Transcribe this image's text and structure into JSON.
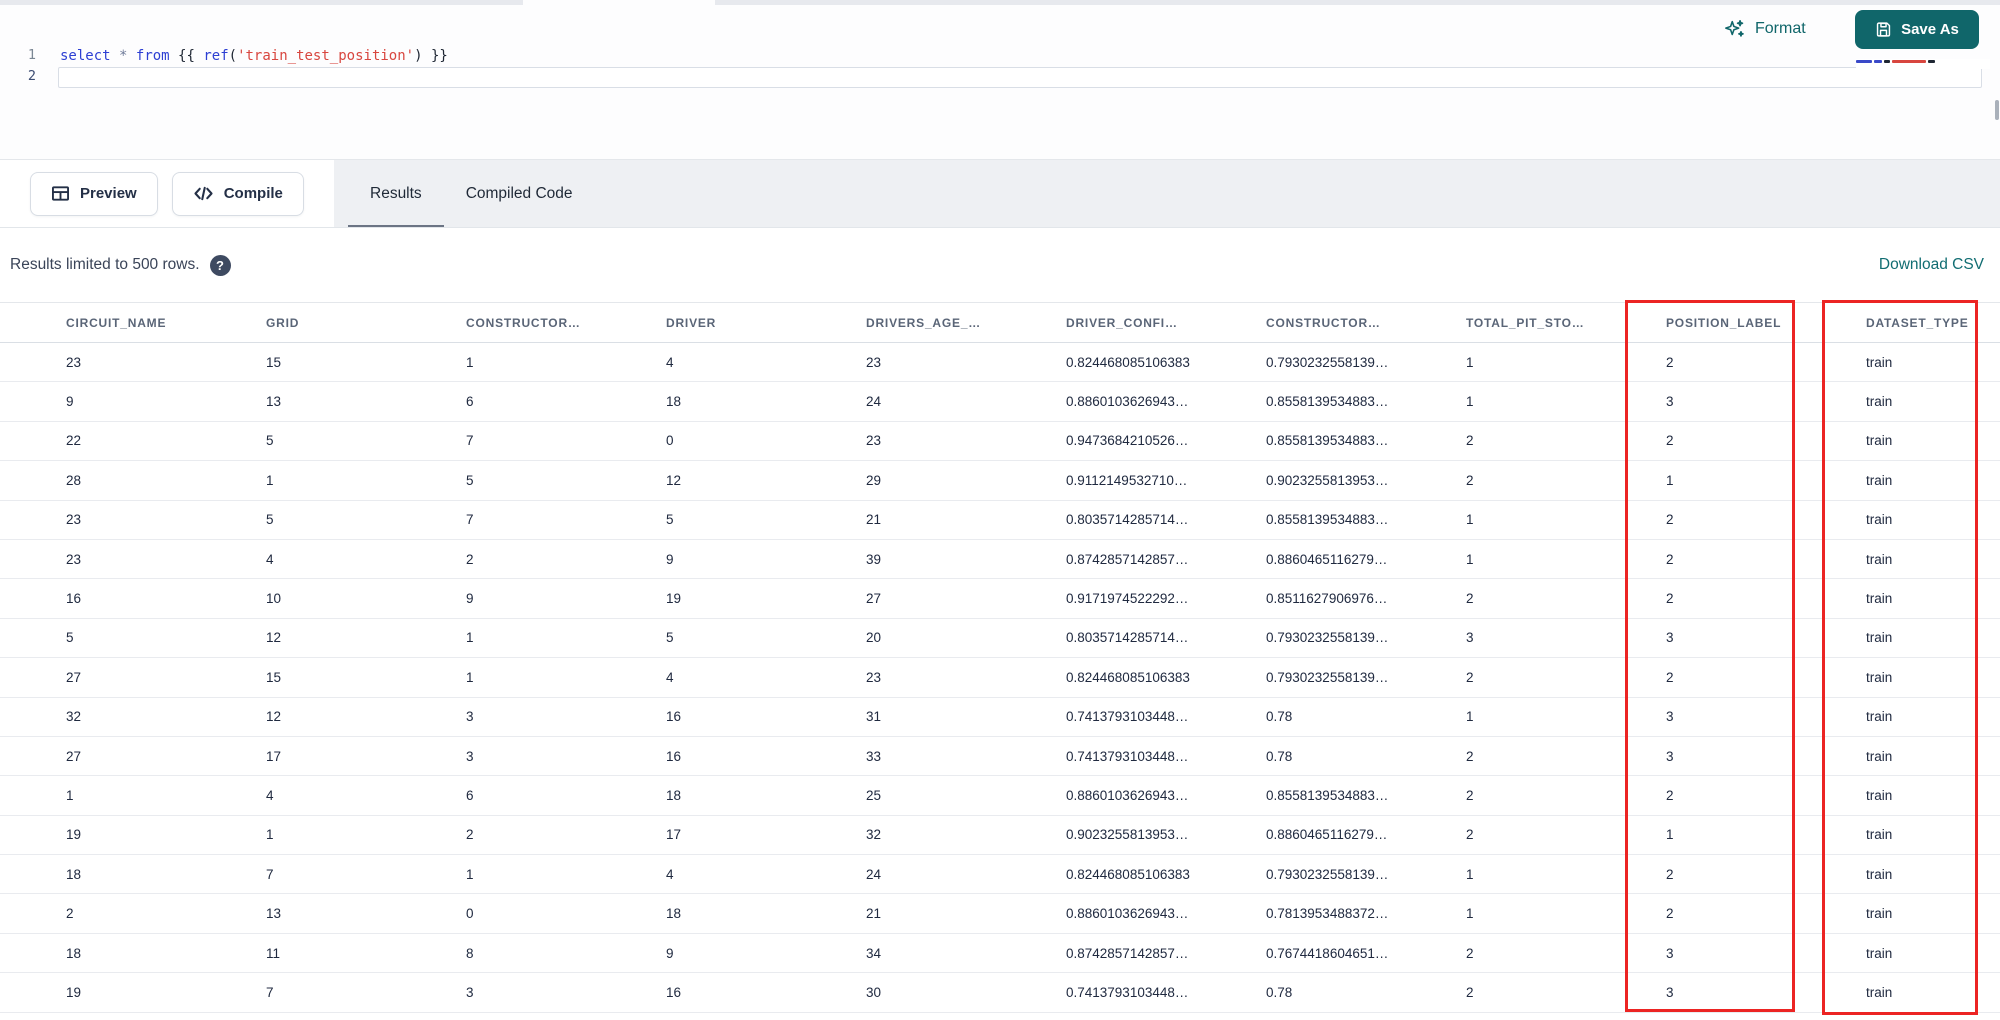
{
  "colors": {
    "accent_teal": "#10666a",
    "highlight_red": "#ec2423",
    "keyword_blue": "#2d3fd3",
    "string_red": "#d8463f"
  },
  "editor": {
    "line_numbers": [
      "1",
      "2"
    ],
    "code_tokens": [
      {
        "text": "select",
        "type": "keyword"
      },
      {
        "text": " ",
        "type": "punct"
      },
      {
        "text": "*",
        "type": "operator"
      },
      {
        "text": " ",
        "type": "punct"
      },
      {
        "text": "from",
        "type": "keyword"
      },
      {
        "text": " ",
        "type": "punct"
      },
      {
        "text": "{{ ",
        "type": "punct"
      },
      {
        "text": "ref",
        "type": "function"
      },
      {
        "text": "(",
        "type": "punct"
      },
      {
        "text": "'train_test_position'",
        "type": "string"
      },
      {
        "text": ")",
        "type": "punct"
      },
      {
        "text": " }}",
        "type": "punct"
      }
    ],
    "format_label": "Format",
    "save_as_label": "Save As"
  },
  "toolbar": {
    "preview_label": "Preview",
    "compile_label": "Compile",
    "tabs": [
      {
        "label": "Results",
        "active": true
      },
      {
        "label": "Compiled Code",
        "active": false
      }
    ]
  },
  "results_bar": {
    "limit_text": "Results limited to 500 rows.",
    "help_glyph": "?",
    "download_label": "Download CSV"
  },
  "table": {
    "columns": [
      "CIRCUIT_NAME",
      "GRID",
      "CONSTRUCTOR…",
      "DRIVER",
      "DRIVERS_AGE_…",
      "DRIVER_CONFI…",
      "CONSTRUCTOR…",
      "TOTAL_PIT_STO…",
      "POSITION_LABEL",
      "DATASET_TYPE"
    ],
    "highlighted_columns": [
      "POSITION_LABEL",
      "DATASET_TYPE"
    ],
    "rows": [
      [
        "23",
        "15",
        "1",
        "4",
        "23",
        "0.824468085106383",
        "0.7930232558139…",
        "1",
        "2",
        "train"
      ],
      [
        "9",
        "13",
        "6",
        "18",
        "24",
        "0.8860103626943…",
        "0.8558139534883…",
        "1",
        "3",
        "train"
      ],
      [
        "22",
        "5",
        "7",
        "0",
        "23",
        "0.9473684210526…",
        "0.8558139534883…",
        "2",
        "2",
        "train"
      ],
      [
        "28",
        "1",
        "5",
        "12",
        "29",
        "0.9112149532710…",
        "0.9023255813953…",
        "2",
        "1",
        "train"
      ],
      [
        "23",
        "5",
        "7",
        "5",
        "21",
        "0.8035714285714…",
        "0.8558139534883…",
        "1",
        "2",
        "train"
      ],
      [
        "23",
        "4",
        "2",
        "9",
        "39",
        "0.8742857142857…",
        "0.8860465116279…",
        "1",
        "2",
        "train"
      ],
      [
        "16",
        "10",
        "9",
        "19",
        "27",
        "0.9171974522292…",
        "0.8511627906976…",
        "2",
        "2",
        "train"
      ],
      [
        "5",
        "12",
        "1",
        "5",
        "20",
        "0.8035714285714…",
        "0.7930232558139…",
        "3",
        "3",
        "train"
      ],
      [
        "27",
        "15",
        "1",
        "4",
        "23",
        "0.824468085106383",
        "0.7930232558139…",
        "2",
        "2",
        "train"
      ],
      [
        "32",
        "12",
        "3",
        "16",
        "31",
        "0.7413793103448…",
        "0.78",
        "1",
        "3",
        "train"
      ],
      [
        "27",
        "17",
        "3",
        "16",
        "33",
        "0.7413793103448…",
        "0.78",
        "2",
        "3",
        "train"
      ],
      [
        "1",
        "4",
        "6",
        "18",
        "25",
        "0.8860103626943…",
        "0.8558139534883…",
        "2",
        "2",
        "train"
      ],
      [
        "19",
        "1",
        "2",
        "17",
        "32",
        "0.9023255813953…",
        "0.8860465116279…",
        "2",
        "1",
        "train"
      ],
      [
        "18",
        "7",
        "1",
        "4",
        "24",
        "0.824468085106383",
        "0.7930232558139…",
        "1",
        "2",
        "train"
      ],
      [
        "2",
        "13",
        "0",
        "18",
        "21",
        "0.8860103626943…",
        "0.7813953488372…",
        "1",
        "2",
        "train"
      ],
      [
        "18",
        "11",
        "8",
        "9",
        "34",
        "0.8742857142857…",
        "0.7674418604651…",
        "2",
        "3",
        "train"
      ],
      [
        "19",
        "7",
        "3",
        "16",
        "30",
        "0.7413793103448…",
        "0.78",
        "2",
        "3",
        "train"
      ]
    ]
  }
}
